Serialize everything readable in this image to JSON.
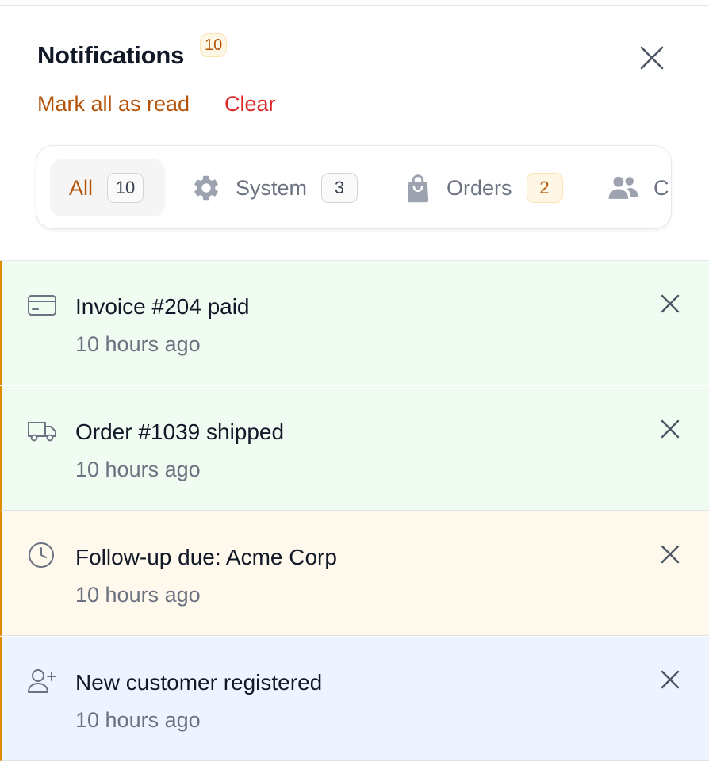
{
  "header": {
    "title": "Notifications",
    "badge_count": "10",
    "mark_all_read": "Mark all as read",
    "clear": "Clear"
  },
  "tabs": [
    {
      "label": "All",
      "count": "10",
      "active": true,
      "icon": "none"
    },
    {
      "label": "System",
      "count": "3",
      "icon": "gear-icon"
    },
    {
      "label": "Orders",
      "count": "2",
      "icon": "shopping-bag-icon"
    },
    {
      "label": "C",
      "icon": "users-icon"
    }
  ],
  "notifications": [
    {
      "title": "Invoice #204 paid",
      "time": "10 hours ago",
      "icon": "credit-card-icon",
      "bg": "#f0fbf1"
    },
    {
      "title": "Order #1039 shipped",
      "time": "10 hours ago",
      "icon": "truck-icon",
      "bg": "#f0fbf1"
    },
    {
      "title": "Follow-up due: Acme Corp",
      "time": "10 hours ago",
      "icon": "clock-icon",
      "bg": "#fff8ec"
    },
    {
      "title": "New customer registered",
      "time": "10 hours ago",
      "icon": "user-plus-icon",
      "bg": "#eef4ff"
    }
  ],
  "colors": {
    "accent": "#b45309",
    "danger": "#dc2626",
    "unread_bar": "#e08a00"
  }
}
